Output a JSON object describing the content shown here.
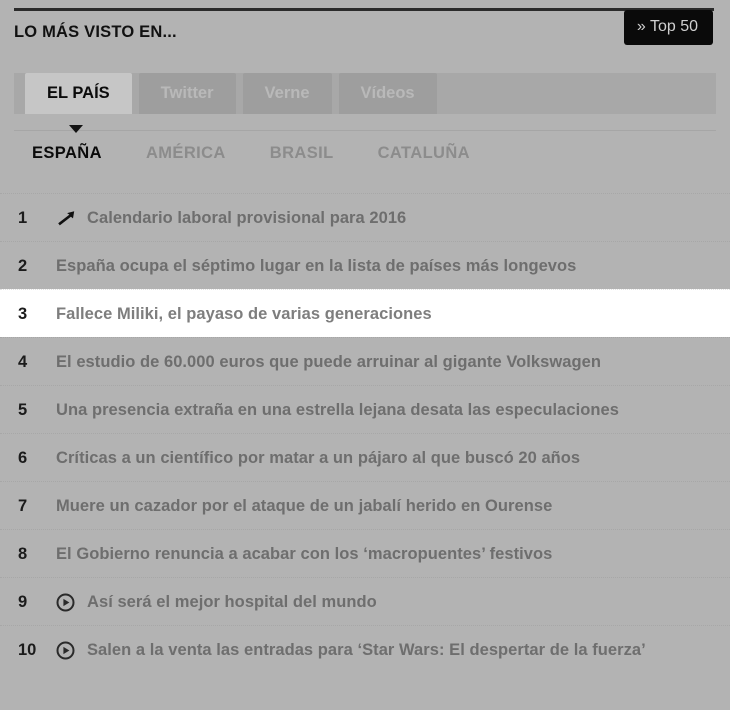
{
  "header": {
    "title": "LO MÁS VISTO EN...",
    "top50_label": "» Top 50"
  },
  "source_tabs": [
    {
      "label": "EL PAÍS",
      "active": true
    },
    {
      "label": "Twitter",
      "active": false
    },
    {
      "label": "Verne",
      "active": false
    },
    {
      "label": "Vídeos",
      "active": false
    }
  ],
  "section_nav": [
    {
      "label": "ESPAÑA",
      "active": true
    },
    {
      "label": "AMÉRICA",
      "active": false
    },
    {
      "label": "BRASIL",
      "active": false
    },
    {
      "label": "CATALUÑA",
      "active": false
    }
  ],
  "ranking": [
    {
      "rank": "1",
      "icon": "trending-up-icon",
      "title": "Calendario laboral provisional para 2016",
      "hovered": false
    },
    {
      "rank": "2",
      "icon": "none",
      "title": "España ocupa el séptimo lugar en la lista de países más longevos",
      "hovered": false
    },
    {
      "rank": "3",
      "icon": "none",
      "title": "Fallece Miliki, el payaso de varias generaciones",
      "hovered": true
    },
    {
      "rank": "4",
      "icon": "none",
      "title": "El estudio de 60.000 euros que puede arruinar al gigante Volkswagen",
      "hovered": false
    },
    {
      "rank": "5",
      "icon": "none",
      "title": "Una presencia extraña en una estrella lejana desata las especulaciones",
      "hovered": false
    },
    {
      "rank": "6",
      "icon": "none",
      "title": "Críticas a un científico por matar a un pájaro al que buscó 20 años",
      "hovered": false
    },
    {
      "rank": "7",
      "icon": "none",
      "title": "Muere un cazador por el ataque de un jabalí herido en Ourense",
      "hovered": false
    },
    {
      "rank": "8",
      "icon": "none",
      "title": "El Gobierno renuncia a acabar con los ‘macropuentes’ festivos",
      "hovered": false
    },
    {
      "rank": "9",
      "icon": "video-play-icon",
      "title": "Así será el mejor hospital del mundo",
      "hovered": false
    },
    {
      "rank": "10",
      "icon": "video-play-icon",
      "title": "Salen a la venta las entradas para ‘Star Wars: El despertar de la fuerza’",
      "hovered": false
    }
  ],
  "colors": {
    "page_background": "#b3b3b3",
    "accent_black": "#0a0a0a",
    "hover_row": "#ffffff",
    "tab_active_background": "#c6c6c6",
    "tab_inactive_background": "#9e9e9e",
    "title_text": "#6e6e6e"
  }
}
